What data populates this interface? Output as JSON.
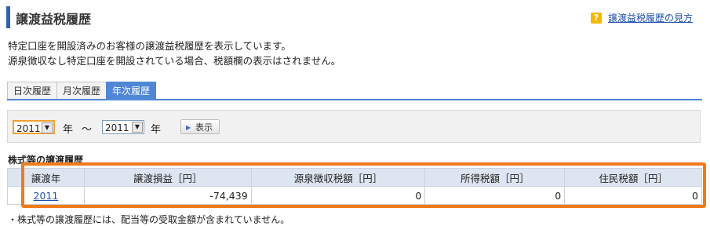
{
  "page": {
    "title": "譲渡益税履歴",
    "help_link": "譲渡益税履歴の見方",
    "description_line1": "特定口座を開設済みのお客様の譲渡益税履歴を表示しています。",
    "description_line2": "源泉徴収なし特定口座を開設されている場合、税額欄の表示はされません。"
  },
  "tabs": [
    {
      "label": "日次履歴"
    },
    {
      "label": "月次履歴"
    },
    {
      "label": "年次履歴"
    }
  ],
  "filter": {
    "from_year": "2011",
    "to_year": "2011",
    "year_suffix": "年",
    "range_sep": "～",
    "show_button": "表示"
  },
  "section_title": "株式等の譲渡履歴",
  "table": {
    "headers": [
      "譲渡年",
      "譲渡損益［円］",
      "源泉徴収税額［円］",
      "所得税額［円］",
      "住民税額［円］"
    ],
    "row": {
      "year": "2011",
      "gain_loss": "-74,439",
      "withholding_tax": "0",
      "income_tax": "0",
      "resident_tax": "0"
    }
  },
  "note": "・株式等の譲渡履歴には、配当等の受取金額が含まれていません。",
  "colors": {
    "accent": "#2f63a8",
    "tab_active": "#4f86d6",
    "highlight": "#f07a1a",
    "header_bg": "#dde5f1"
  }
}
